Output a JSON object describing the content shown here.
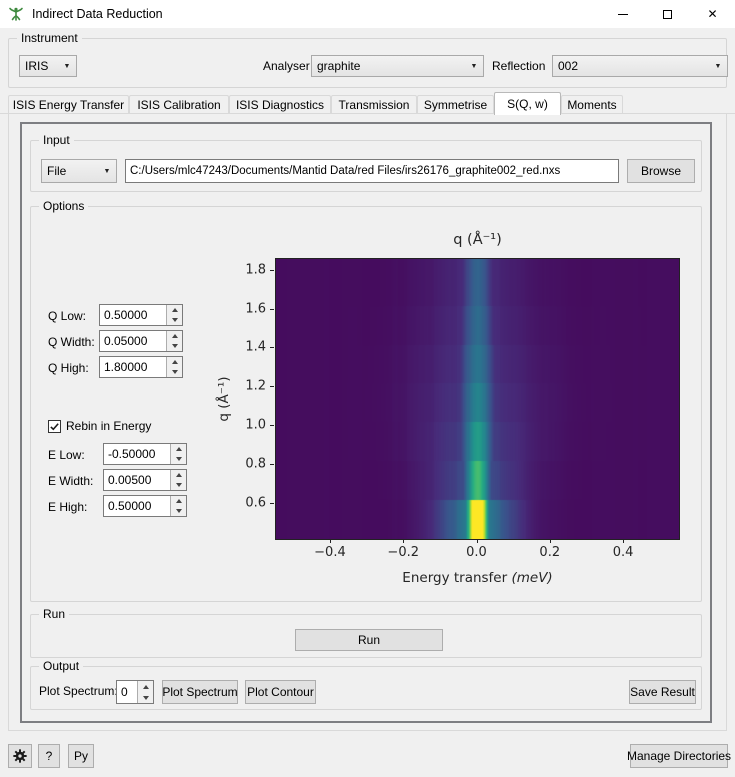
{
  "window": {
    "title": "Indirect Data Reduction"
  },
  "instrument": {
    "group_label": "Instrument",
    "instrument_value": "IRIS",
    "analyser_label": "Analyser",
    "analyser_value": "graphite",
    "reflection_label": "Reflection",
    "reflection_value": "002"
  },
  "tabs": [
    {
      "label": "ISIS Energy Transfer",
      "selected": false
    },
    {
      "label": "ISIS Calibration",
      "selected": false
    },
    {
      "label": "ISIS Diagnostics",
      "selected": false
    },
    {
      "label": "Transmission",
      "selected": false
    },
    {
      "label": "Symmetrise",
      "selected": false
    },
    {
      "label": "S(Q, w)",
      "selected": true
    },
    {
      "label": "Moments",
      "selected": false
    }
  ],
  "input": {
    "group_label": "Input",
    "source_selector_value": "File",
    "file_path": "C:/Users/mlc47243/Documents/Mantid Data/red Files/irs26176_graphite002_red.nxs",
    "browse_label": "Browse"
  },
  "options": {
    "group_label": "Options",
    "q_low_label": "Q Low:",
    "q_low_value": "0.50000",
    "q_width_label": "Q Width:",
    "q_width_value": "0.05000",
    "q_high_label": "Q High:",
    "q_high_value": "1.80000",
    "rebin_label": "Rebin in Energy",
    "rebin_checked": true,
    "e_low_label": "E Low:",
    "e_low_value": "-0.50000",
    "e_width_label": "E Width:",
    "e_width_value": "0.00500",
    "e_high_label": "E High:",
    "e_high_value": "0.50000"
  },
  "chart_data": {
    "type": "heatmap",
    "title": "q (Å⁻¹)",
    "xlabel": "Energy transfer ",
    "xlabel_unit": "(meV)",
    "ylabel": "q (Å⁻¹)",
    "xlim": [
      -0.55,
      0.55
    ],
    "ylim": [
      0.42,
      1.86
    ],
    "x_ticks": [
      {
        "value": -0.4,
        "label": "−0.4"
      },
      {
        "value": -0.2,
        "label": "−0.2"
      },
      {
        "value": 0.0,
        "label": "0.0"
      },
      {
        "value": 0.2,
        "label": "0.2"
      },
      {
        "value": 0.4,
        "label": "0.4"
      }
    ],
    "y_ticks": [
      {
        "value": 0.6,
        "label": "0.6"
      },
      {
        "value": 0.8,
        "label": "0.8"
      },
      {
        "value": 1.0,
        "label": "1.0"
      },
      {
        "value": 1.2,
        "label": "1.2"
      },
      {
        "value": 1.4,
        "label": "1.4"
      },
      {
        "value": 1.6,
        "label": "1.6"
      },
      {
        "value": 1.8,
        "label": "1.8"
      }
    ],
    "colormap": "viridis",
    "peak_center_x": 0.0,
    "background_level": 0.035,
    "halo": {
      "amplitude_ratio": 0.3,
      "width_ratio": 3.8
    },
    "column_striping": 0.07,
    "rows": [
      {
        "q_min": 0.42,
        "q_max": 0.62,
        "peak": 1.35,
        "sigma": 0.02
      },
      {
        "q_min": 0.62,
        "q_max": 0.82,
        "peak": 0.72,
        "sigma": 0.024
      },
      {
        "q_min": 0.82,
        "q_max": 1.02,
        "peak": 0.57,
        "sigma": 0.028
      },
      {
        "q_min": 1.02,
        "q_max": 1.22,
        "peak": 0.47,
        "sigma": 0.03
      },
      {
        "q_min": 1.22,
        "q_max": 1.42,
        "peak": 0.41,
        "sigma": 0.03
      },
      {
        "q_min": 1.42,
        "q_max": 1.62,
        "peak": 0.37,
        "sigma": 0.028
      },
      {
        "q_min": 1.62,
        "q_max": 1.86,
        "peak": 0.34,
        "sigma": 0.026
      }
    ]
  },
  "run": {
    "group_label": "Run",
    "run_label": "Run"
  },
  "output": {
    "group_label": "Output",
    "plot_spectrum_label": "Plot Spectrum:",
    "spectrum_value": "0",
    "plot_spectrum_button": "Plot Spectrum",
    "plot_contour_button": "Plot Contour",
    "save_result_button": "Save Result"
  },
  "footer": {
    "help_label": "?",
    "python_label": "Py",
    "manage_directories_label": "Manage Directories"
  }
}
